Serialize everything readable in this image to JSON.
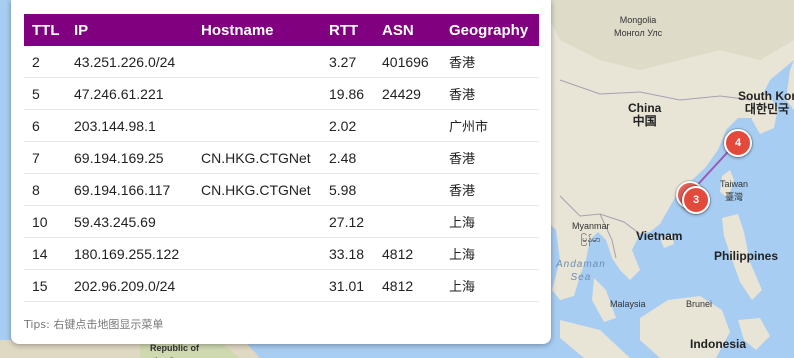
{
  "table": {
    "headers": {
      "ttl": "TTL",
      "ip": "IP",
      "hostname": "Hostname",
      "rtt": "RTT",
      "asn": "ASN",
      "geography": "Geography"
    },
    "rows": [
      {
        "ttl": "2",
        "ip": "43.251.226.0/24",
        "hostname": "",
        "rtt": "3.27",
        "asn": "401696",
        "geography": "香港"
      },
      {
        "ttl": "5",
        "ip": "47.246.61.221",
        "hostname": "",
        "rtt": "19.86",
        "asn": "24429",
        "geography": "香港"
      },
      {
        "ttl": "6",
        "ip": "203.144.98.1",
        "hostname": "",
        "rtt": "2.02",
        "asn": "",
        "geography": "广州市"
      },
      {
        "ttl": "7",
        "ip": "69.194.169.25",
        "hostname": "CN.HKG.CTGNet",
        "rtt": "2.48",
        "asn": "",
        "geography": "香港"
      },
      {
        "ttl": "8",
        "ip": "69.194.166.117",
        "hostname": "CN.HKG.CTGNet",
        "rtt": "5.98",
        "asn": "",
        "geography": "香港"
      },
      {
        "ttl": "10",
        "ip": "59.43.245.69",
        "hostname": "",
        "rtt": "27.12",
        "asn": "",
        "geography": "上海"
      },
      {
        "ttl": "14",
        "ip": "180.169.255.122",
        "hostname": "",
        "rtt": "33.18",
        "asn": "4812",
        "geography": "上海"
      },
      {
        "ttl": "15",
        "ip": "202.96.209.0/24",
        "hostname": "",
        "rtt": "31.01",
        "asn": "4812",
        "geography": "上海"
      }
    ]
  },
  "tips": "Tips: 右键点击地图显示菜单",
  "map": {
    "labels": {
      "mongolia": "Mongolia",
      "mongolia_cn": "Монгол Улс",
      "china": "China",
      "china_cn": "中国",
      "south_korea": "South Kor",
      "south_korea_cn": "대한민국",
      "taiwan": "Taiwan",
      "taiwan_cn": "臺灣",
      "myanmar": "Myanmar",
      "myanmar_native": "မြန်မာ",
      "vietnam": "Vietnam",
      "philippines": "Philippines",
      "andaman_sea": "Andaman\nSea",
      "malaysia": "Malaysia",
      "brunei": "Brunei",
      "indonesia": "Indonesia",
      "republic_congo": "Republic of\nthe Congo"
    },
    "markers": [
      {
        "label": "4"
      },
      {
        "label": "3"
      }
    ],
    "colors": {
      "marker": "#e44a3c",
      "route": "#9b59b6",
      "header": "#800080"
    }
  }
}
